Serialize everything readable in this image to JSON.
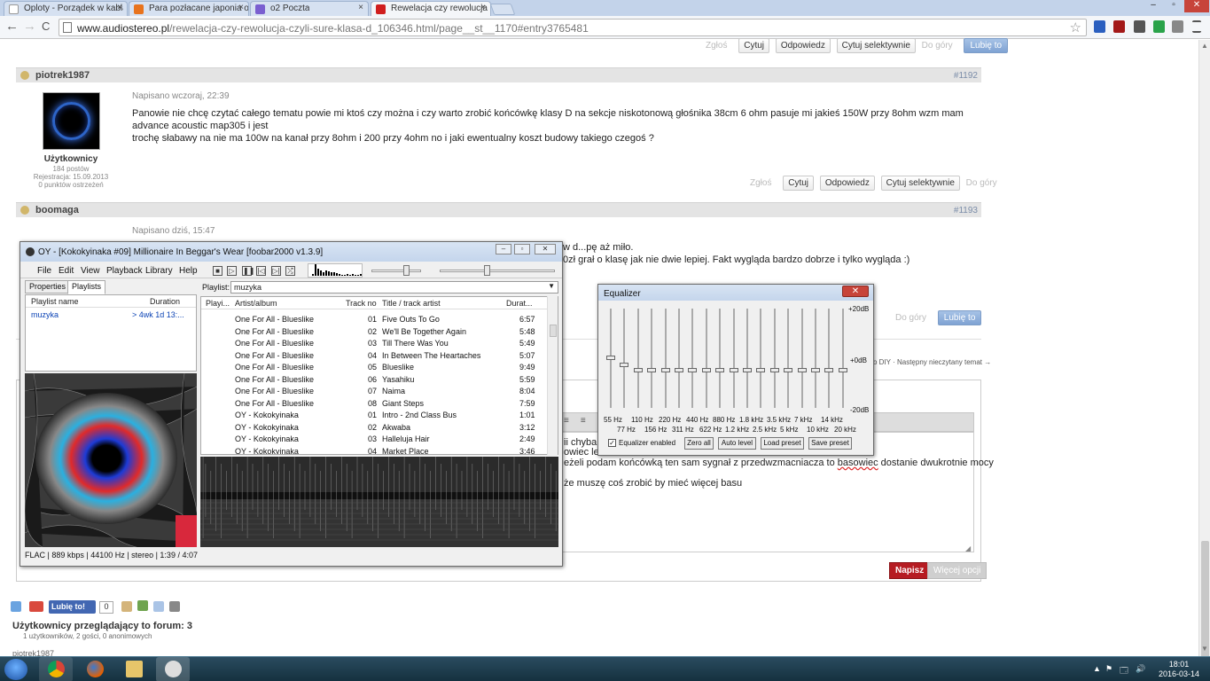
{
  "browser": {
    "tabs": [
      {
        "title": "Oploty - Porządek w kabla",
        "close": "×",
        "color": "#ffffff"
      },
      {
        "title": "Para pozłacane japonia oy",
        "close": "×",
        "color": "#e8731d"
      },
      {
        "title": "o2 Poczta",
        "close": "×",
        "color": "#7a5fd0"
      },
      {
        "title": "Rewelacja czy rewolucja -",
        "close": "×",
        "color": "#d01e1e"
      }
    ],
    "window_controls": [
      "–",
      "▫",
      "✕"
    ],
    "nav": {
      "back": "←",
      "forward": "→",
      "reload": "C"
    },
    "url_host": "www.audiostereo.pl",
    "url_path": "/rewelacja-czy-rewolucja-czyli-sure-klasa-d_106346.html/page__st__1170#entry3765481",
    "star": "☆"
  },
  "forum": {
    "top_actions": {
      "report": "Zgłoś",
      "quote": "Cytuj",
      "reply": "Odpowiedz",
      "quote_sel": "Cytuj selektywnie",
      "up": "Do góry",
      "like": "Lubię to"
    },
    "post1": {
      "author": "piotrek1987",
      "num": "#1192",
      "date": "Napisano wczoraj, 22:39",
      "group": "Użytkownicy",
      "posts": "184 postów",
      "registered": "Rejestracja: 15.09.2013",
      "warnings": "0 punktów ostrzeżeń",
      "text_line1": "Panowie nie chcę czytać całego tematu powie mi ktoś czy można i czy warto zrobić końcówkę klasy D na sekcje niskotonową głośnika 38cm 6 ohm pasuje mi jakieś 150W przy 8ohm wzm mam advance acoustic map305 i jest",
      "text_line2": "trochę słabawy na nie ma 100w na kanał przy 8ohm i 200 przy 4ohm no i jaki ewentualny koszt budowy takiego czegoś ?",
      "actions": {
        "report": "Zgłoś",
        "quote": "Cytuj",
        "reply": "Odpowiedz",
        "quote_sel": "Cytuj selektywnie",
        "up": "Do góry"
      }
    },
    "post2": {
      "author": "boomaga",
      "num": "#1193",
      "date": "Napisano dziś, 15:47",
      "text_line1": "w d...pę aż miło.",
      "text_line2": "0zł grał o klasę jak nie dwie lepiej. Fakt wygląda bardzo dobrze i tylko wygląda :)",
      "up": "Do góry",
      "like": "Lubię to"
    },
    "pager_next": "o DIY  ·  Następny nieczytany temat →",
    "editor": {
      "line1": "ii chyba z",
      "line2": "owiec led",
      "line3_a": "eżeli podam końcówką ten sam sygnał z przedwzmacniacza to ",
      "line3_err": "basowiec",
      "line3_b": " dostanie dwukrotnie mocy",
      "line4": "że muszę coś zrobić by mieć więcej basu",
      "toolbar_glyphs": [
        "≡",
        "≡",
        "≡"
      ],
      "submit": "Napisz",
      "more": "Więcej opcji"
    },
    "share": {
      "like": "Lubię to!",
      "count": "0"
    },
    "viewers_title": "Użytkownicy przeglądający to forum: 3",
    "viewers_sub": "1 użytkowników, 2 gości, 0 anonimowych",
    "viewers_names": "piotrek1987"
  },
  "foobar": {
    "title": "OY - [Kokokyinaka #09] Millionaire In Beggar's Wear   [foobar2000 v1.3.9]",
    "menu": [
      "File",
      "Edit",
      "View",
      "Playback",
      "Library",
      "Help"
    ],
    "transport": [
      "■",
      "▷",
      "❚❚",
      "|◁",
      "▷|",
      "⤮"
    ],
    "viz_levels": [
      0.15,
      0.9,
      0.6,
      0.45,
      0.3,
      0.4,
      0.35,
      0.25,
      0.3,
      0.2,
      0.15,
      0.1,
      0.1,
      0.15,
      0.1,
      0.12,
      0.1,
      0.08,
      0.12
    ],
    "volume_level": 0.7,
    "seek_position": 0.4,
    "tabs": [
      "Properties",
      "Playlists"
    ],
    "playlist_manager": {
      "col_name": "Playlist name",
      "col_dur": "Duration",
      "name": "muzyka",
      "duration": "> 4wk 1d 13:..."
    },
    "playlist_label": "Playlist:",
    "playlist_value": "muzyka",
    "columns": {
      "playing": "Playi...",
      "artist": "Artist/album",
      "track": "Track no",
      "title": "Title / track artist",
      "dur": "Durat..."
    },
    "rows": [
      {
        "artist": "One For All - Blueslike",
        "track": "01",
        "title": "Five Outs To Go",
        "dur": "6:57"
      },
      {
        "artist": "One For All - Blueslike",
        "track": "02",
        "title": "We'll Be Together Again",
        "dur": "5:48"
      },
      {
        "artist": "One For All - Blueslike",
        "track": "03",
        "title": "Till There Was You",
        "dur": "5:49"
      },
      {
        "artist": "One For All - Blueslike",
        "track": "04",
        "title": "In Between The Heartaches",
        "dur": "5:07"
      },
      {
        "artist": "One For All - Blueslike",
        "track": "05",
        "title": "Blueslike",
        "dur": "9:49"
      },
      {
        "artist": "One For All - Blueslike",
        "track": "06",
        "title": "Yasahiku",
        "dur": "5:59"
      },
      {
        "artist": "One For All - Blueslike",
        "track": "07",
        "title": "Naima",
        "dur": "8:04"
      },
      {
        "artist": "One For All - Blueslike",
        "track": "08",
        "title": "Giant Steps",
        "dur": "7:59"
      },
      {
        "artist": "OY - Kokokyinaka",
        "track": "01",
        "title": "Intro - 2nd Class Bus",
        "dur": "1:01"
      },
      {
        "artist": "OY - Kokokyinaka",
        "track": "02",
        "title": "Akwaba",
        "dur": "3:12"
      },
      {
        "artist": "OY - Kokokyinaka",
        "track": "03",
        "title": "Halleluja Hair",
        "dur": "2:49"
      },
      {
        "artist": "OY - Kokokyinaka",
        "track": "04",
        "title": "Market Place",
        "dur": "3:46"
      }
    ],
    "status": "FLAC | 889 kbps | 44100 Hz | stereo | 1:39 / 4:07"
  },
  "equalizer": {
    "title": "Equalizer",
    "close": "✕",
    "db_top": "+20dB",
    "db_mid": "+0dB",
    "db_bot": "-20dB",
    "freq_row1": [
      "55 Hz",
      "110 Hz",
      "220 Hz",
      "440 Hz",
      "880 Hz",
      "1.8 kHz",
      "3.5 kHz",
      "7 kHz",
      "14 kHz"
    ],
    "freq_row2": [
      "77 Hz",
      "156 Hz",
      "311 Hz",
      "622 Hz",
      "1.2 kHz",
      "2.5 kHz",
      "5 kHz",
      "10 kHz",
      "20 kHz"
    ],
    "band_gains_db": [
      0,
      -3,
      -5,
      -5,
      -5,
      -5,
      -5,
      -5,
      -5,
      -5,
      -5,
      -5,
      -5,
      -5,
      -5,
      -5,
      -5,
      -5
    ],
    "enabled_label": "Equalizer enabled",
    "enabled_mark": "✓",
    "buttons": [
      "Zero all",
      "Auto level",
      "Load preset",
      "Save preset"
    ]
  },
  "taskbar": {
    "clock_time": "18:01",
    "clock_date": "2016-03-14",
    "tray": [
      "▲",
      "⚑",
      "🗔",
      "🔊"
    ]
  }
}
